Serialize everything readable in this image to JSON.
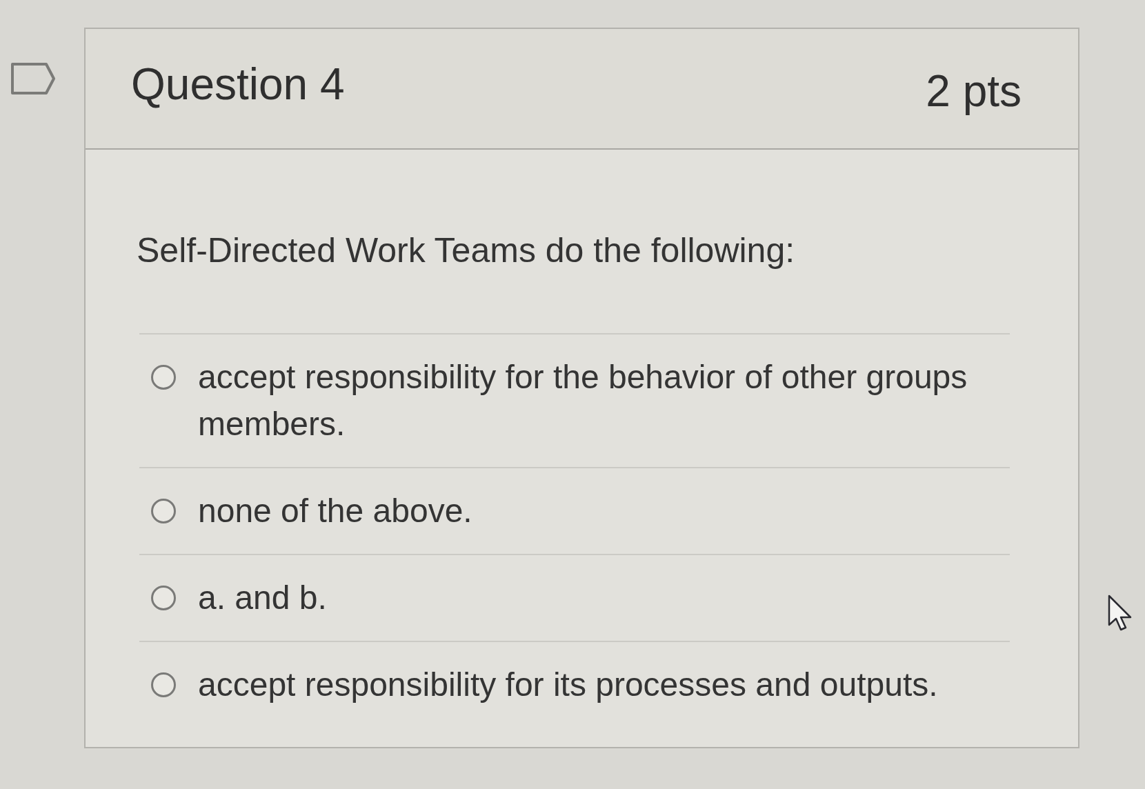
{
  "question": {
    "title": "Question 4",
    "points": "2 pts",
    "text": "Self-Directed Work Teams do the following:",
    "answers": [
      {
        "label": "accept responsibility for the behavior of other groups members.",
        "selected": false
      },
      {
        "label": "none of the above.",
        "selected": false
      },
      {
        "label": "a. and b.",
        "selected": false
      },
      {
        "label": "accept responsibility for its processes and outputs.",
        "selected": false
      }
    ]
  }
}
